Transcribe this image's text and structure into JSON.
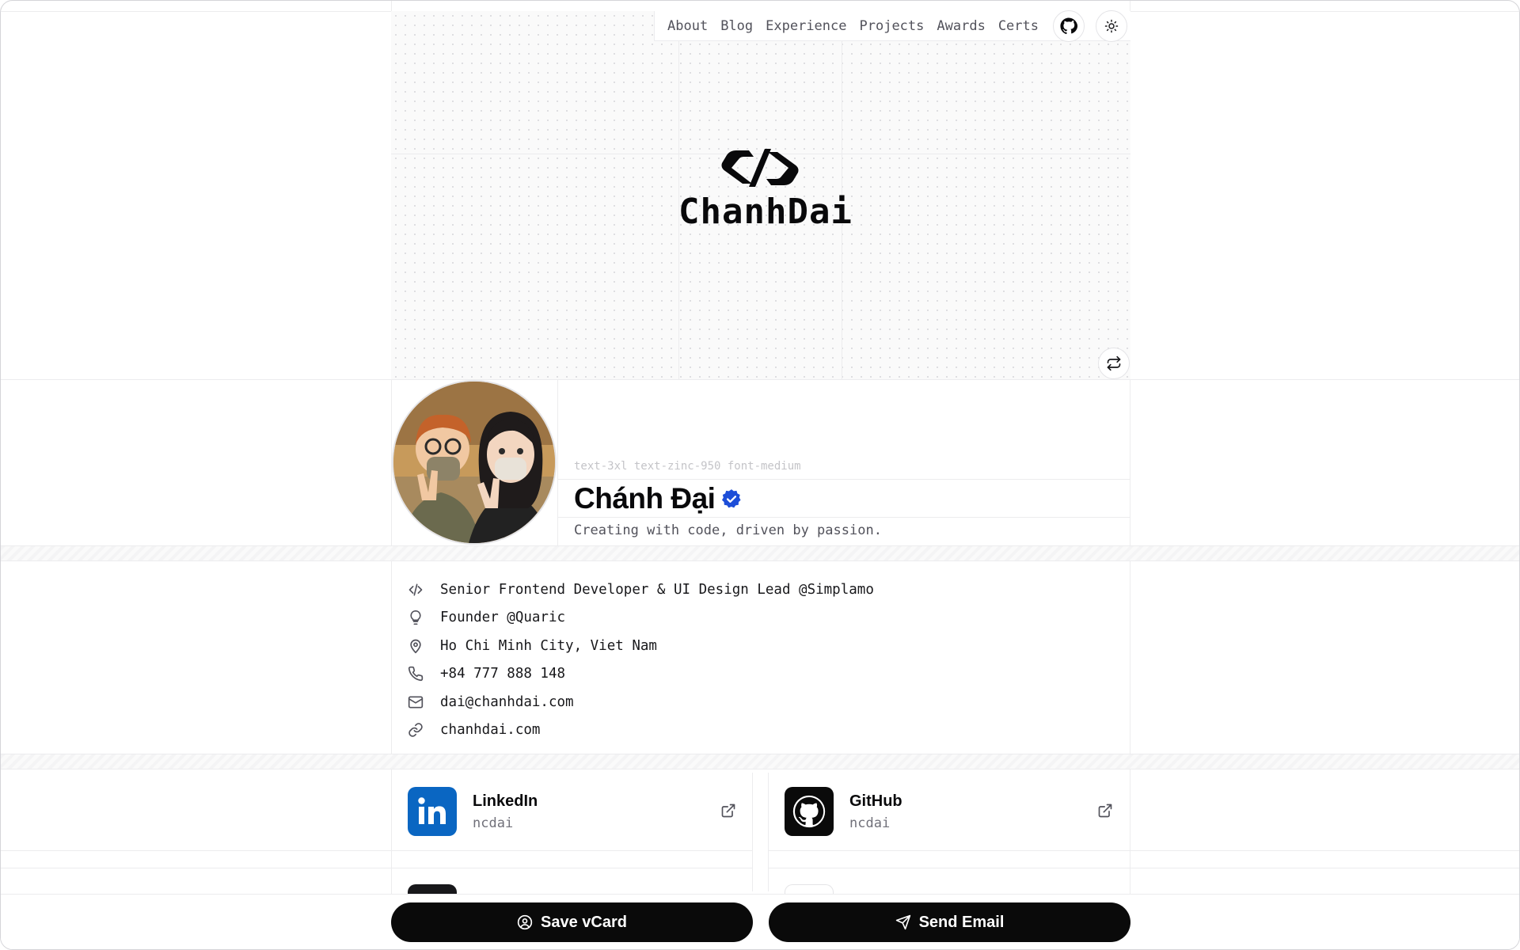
{
  "nav": {
    "links": [
      "About",
      "Blog",
      "Experience",
      "Projects",
      "Awards",
      "Certs"
    ],
    "github_icon": "github-icon",
    "theme_icon": "sun-icon"
  },
  "hero": {
    "logo_text": "ChanhDai",
    "logo_icon": "code-brackets-logo",
    "swap_icon": "repeat-icon"
  },
  "profile": {
    "class_hint": "text-3xl text-zinc-950 font-medium",
    "name": "Chánh Đại",
    "verified_icon": "verified-badge-icon",
    "tagline": "Creating with code, driven by passion."
  },
  "info": [
    {
      "icon": "code-icon",
      "text": "Senior Frontend Developer & UI Design Lead @Simplamo"
    },
    {
      "icon": "lightbulb-icon",
      "text": "Founder @Quaric"
    },
    {
      "icon": "map-pin-icon",
      "text": "Ho Chi Minh City, Viet Nam"
    },
    {
      "icon": "phone-icon",
      "text": "+84 777 888 148"
    },
    {
      "icon": "mail-icon",
      "text": "dai@chanhdai.com"
    },
    {
      "icon": "link-icon",
      "text": "chanhdai.com"
    }
  ],
  "socials": [
    {
      "title": "LinkedIn",
      "handle": "ncdai",
      "icon": "linkedin-icon",
      "color": "#0a66c2"
    },
    {
      "title": "GitHub",
      "handle": "ncdai",
      "icon": "github-icon",
      "color": "#0a0a0a"
    }
  ],
  "actions": {
    "save_vcard": "Save vCard",
    "send_email": "Send Email"
  },
  "colors": {
    "accent_verified": "#1d4ed8",
    "button_bg": "#0a0a0a"
  }
}
